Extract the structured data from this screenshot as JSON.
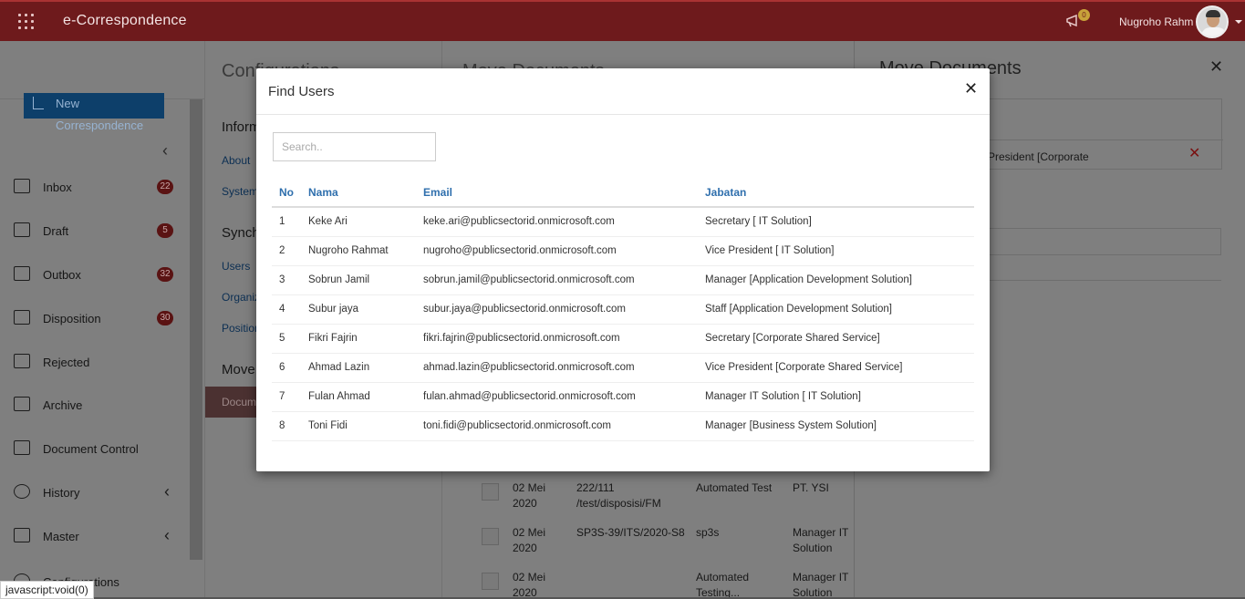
{
  "app": {
    "title": "e-Correspondence",
    "notification_count": "0",
    "user_name": "Nugroho Rahm"
  },
  "sidebar": {
    "new_button": "New Correspondence",
    "items": [
      {
        "label": "Inbox",
        "badge": "22",
        "icon": "inbox-icon"
      },
      {
        "label": "Draft",
        "badge": "5",
        "icon": "draft-icon"
      },
      {
        "label": "Outbox",
        "badge": "32",
        "icon": "outbox-icon"
      },
      {
        "label": "Disposition",
        "badge": "30",
        "icon": "disposition-icon"
      },
      {
        "label": "Rejected",
        "icon": "rejected-icon"
      },
      {
        "label": "Archive",
        "icon": "archive-icon"
      },
      {
        "label": "Document Control",
        "icon": "document-control-icon"
      },
      {
        "label": "History",
        "icon": "history-icon"
      },
      {
        "label": "Master",
        "icon": "master-icon"
      },
      {
        "label": "Configurations",
        "icon": "gear-icon"
      }
    ]
  },
  "config": {
    "title": "Configurations",
    "sections": [
      {
        "heading": "Information",
        "links": [
          "About",
          "System"
        ]
      },
      {
        "heading": "Synchronization",
        "links": [
          "Users",
          "Organization",
          "Positions"
        ]
      },
      {
        "heading": "Move",
        "links": [
          "Documents"
        ]
      }
    ]
  },
  "documents": {
    "title": "Move Documents",
    "rows": [
      {
        "date": "02 Mei 2020",
        "number": "222/111 /test/disposisi/FM",
        "subject": "Automated Test",
        "from": "PT. YSI"
      },
      {
        "date": "02 Mei 2020",
        "number": "SP3S-39/ITS/2020-S8",
        "subject": "sp3s",
        "from": "Manager IT Solution"
      },
      {
        "date": "02 Mei 2020",
        "number": "",
        "subject": "Automated Testing...",
        "from": "Manager IT Solution"
      }
    ]
  },
  "move_panel": {
    "title": "Move Documents",
    "selected_position": "e President [Corporate",
    "close_icon": "close-icon"
  },
  "status_bar": "javascript:void(0)",
  "modal": {
    "title": "Find Users",
    "search_placeholder": "Search..",
    "columns": [
      "No",
      "Nama",
      "Email",
      "Jabatan"
    ],
    "rows": [
      {
        "no": "1",
        "nama": "Keke Ari",
        "email": "keke.ari@publicsectorid.onmicrosoft.com",
        "jabatan": "Secretary [ IT Solution]"
      },
      {
        "no": "2",
        "nama": "Nugroho Rahmat",
        "email": "nugroho@publicsectorid.onmicrosoft.com",
        "jabatan": "Vice President [ IT Solution]"
      },
      {
        "no": "3",
        "nama": "Sobrun Jamil",
        "email": "sobrun.jamil@publicsectorid.onmicrosoft.com",
        "jabatan": "Manager [Application Development Solution]"
      },
      {
        "no": "4",
        "nama": "Subur jaya",
        "email": "subur.jaya@publicsectorid.onmicrosoft.com",
        "jabatan": "Staff [Application Development Solution]"
      },
      {
        "no": "5",
        "nama": "Fikri Fajrin",
        "email": "fikri.fajrin@publicsectorid.onmicrosoft.com",
        "jabatan": "Secretary [Corporate Shared Service]"
      },
      {
        "no": "6",
        "nama": "Ahmad Lazin",
        "email": "ahmad.lazin@publicsectorid.onmicrosoft.com",
        "jabatan": "Vice President [Corporate Shared Service]"
      },
      {
        "no": "7",
        "nama": "Fulan Ahmad",
        "email": "fulan.ahmad@publicsectorid.onmicrosoft.com",
        "jabatan": "Manager IT Solution [ IT Solution]"
      },
      {
        "no": "8",
        "nama": "Toni Fidi",
        "email": "toni.fidi@publicsectorid.onmicrosoft.com",
        "jabatan": "Manager [Business System Solution]"
      }
    ]
  }
}
